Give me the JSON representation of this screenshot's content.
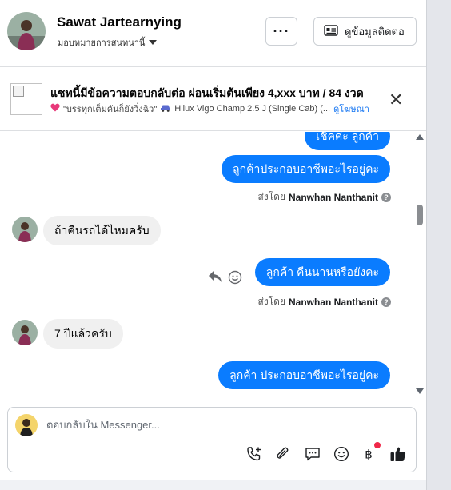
{
  "header": {
    "contact_name": "Sawat Jartearnying",
    "assign_label": "มอบหมายการสนทนานี้",
    "more_label": "···",
    "contact_info_label": "ดูข้อมูลติดต่อ"
  },
  "ad": {
    "title": "แชทนี้มีข้อความตอบกลับต่อ ผ่อนเริ่มต้นเพียง 4,xxx บาท / 84 งวด",
    "subtitle": "\"บรรทุกเต็มคันก็ยังวิ่งฉิว\"",
    "vehicle": "Hilux Vigo Champ 2.5 J (Single Cab) (...",
    "view_ad_label": "ดูโฆษณา"
  },
  "messages": [
    {
      "dir": "out",
      "text": "เช็คค่ะ  ลูกค้า"
    },
    {
      "dir": "out",
      "text": "ลูกค้าประกอบอาชีพอะไรอยู่คะ"
    },
    {
      "sent_by_prefix": "ส่งโดย",
      "sent_by_name": "Nanwhan Nanthanit"
    },
    {
      "dir": "in",
      "text": "ถ้าคืนรถได้ไหมครับ"
    },
    {
      "dir": "out",
      "text": "ลูกค้า คืนนานหรือยังคะ"
    },
    {
      "sent_by_prefix": "ส่งโดย",
      "sent_by_name": "Nanwhan Nanthanit"
    },
    {
      "dir": "in",
      "text": "7 ปีแล้วครับ"
    },
    {
      "dir": "out",
      "text": "ลูกค้า ประกอบอาชีพอะไรอยู่คะ"
    }
  ],
  "composer": {
    "placeholder": "ตอบกลับใน Messenger..."
  },
  "colors": {
    "outgoing_bubble": "#0a7cff",
    "incoming_bubble": "#f0f0f0",
    "accent": "#1877f2",
    "notification_dot": "#f02849"
  },
  "icons": [
    "more-icon",
    "contact-card-icon",
    "close-icon",
    "reply-icon",
    "emoji-icon",
    "phone-add-icon",
    "attachment-icon",
    "saved-reply-icon",
    "emoji-icon",
    "baht-payment-icon",
    "like-icon"
  ]
}
